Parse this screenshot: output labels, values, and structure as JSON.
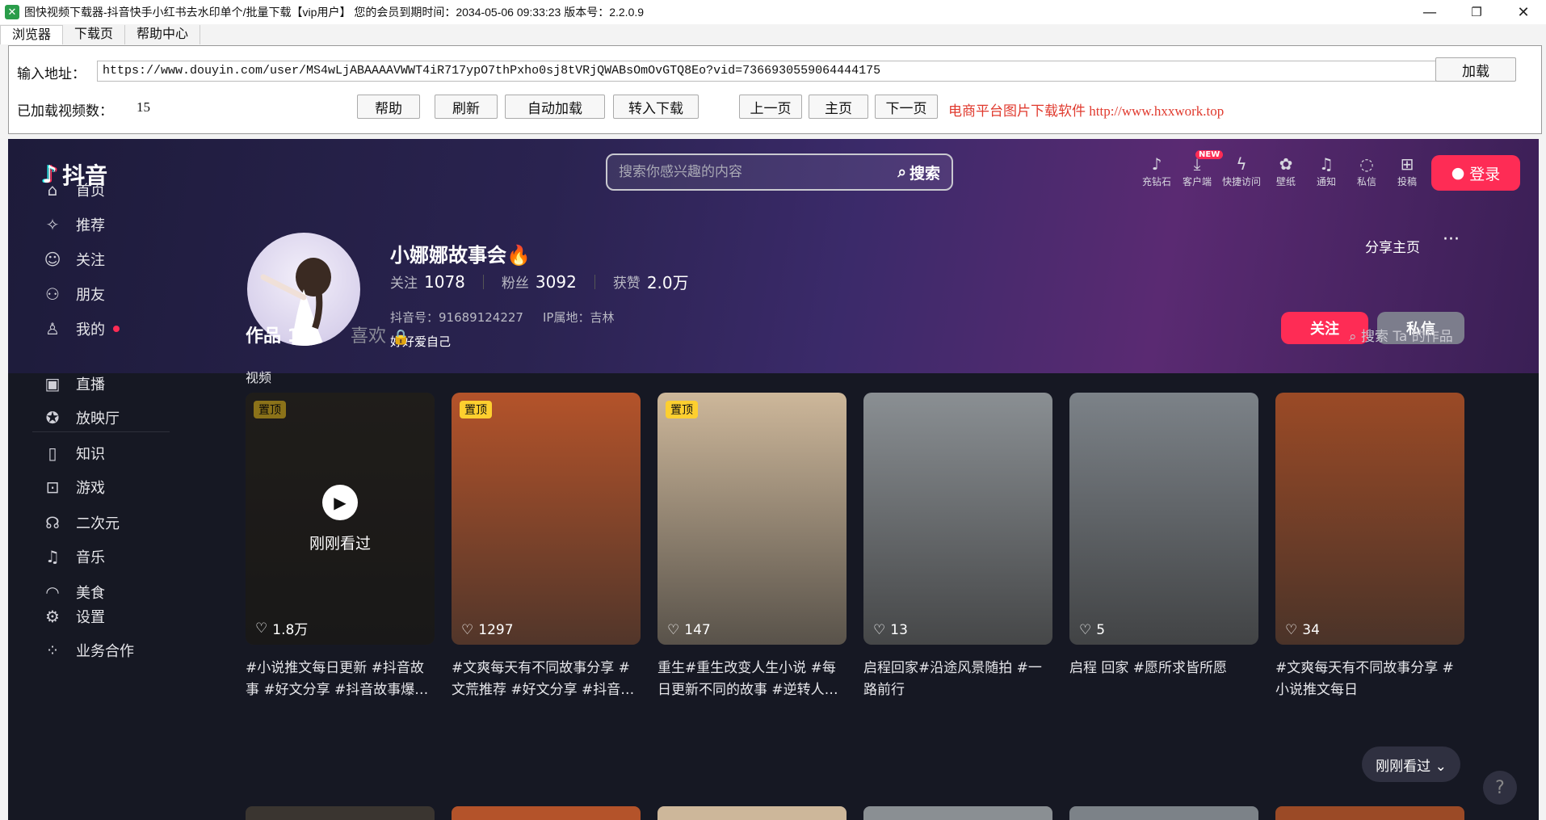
{
  "window": {
    "title": "图快视频下载器-抖音快手小红书去水印单个/批量下载【vip用户】 您的会员到期时间：2034-05-06 09:33:23   版本号：2.2.0.9",
    "minimize": "—",
    "maximize": "❐",
    "close": "✕"
  },
  "menu": {
    "browser": "浏览器",
    "download": "下载页",
    "help": "帮助中心"
  },
  "panel": {
    "url_label": "输入地址：",
    "url_value": "https://www.douyin.com/user/MS4wLjABAAAAVWWT4iR717ypO7thPxho0sj8tVRjQWABsOmOvGTQ8Eo?vid=7366930559064444175",
    "load_button": "加载",
    "loaded_label": "已加载视频数：",
    "loaded_count": "15",
    "btn_help": "帮助",
    "btn_refresh": "刷新",
    "btn_autoload": "自动加载",
    "btn_todownload": "转入下载",
    "btn_prev": "上一页",
    "btn_home": "主页",
    "btn_next": "下一页",
    "ad_text": "电商平台图片下载软件 http://www.hxxwork.top"
  },
  "douyin": {
    "logo_text": "抖音",
    "search_placeholder": "搜索你感兴趣的内容",
    "search_button": "搜索",
    "top_icons": [
      {
        "label": "充钻石",
        "icon": "diamond-icon"
      },
      {
        "label": "客户端",
        "icon": "download-icon"
      },
      {
        "label": "快捷访问",
        "icon": "lightning-icon"
      },
      {
        "label": "壁纸",
        "icon": "wallpaper-icon"
      },
      {
        "label": "通知",
        "icon": "bell-icon"
      },
      {
        "label": "私信",
        "icon": "chat-icon"
      },
      {
        "label": "投稿",
        "icon": "plus-icon"
      }
    ],
    "new_badge": "NEW",
    "login": "登录",
    "nav": [
      {
        "label": "首页",
        "icon": "home-icon"
      },
      {
        "label": "推荐",
        "icon": "sparkle-icon"
      },
      {
        "label": "关注",
        "icon": "follow-icon"
      },
      {
        "label": "朋友",
        "icon": "friends-icon"
      },
      {
        "label": "我的",
        "icon": "user-icon"
      },
      {
        "label": "直播",
        "icon": "tv-icon"
      },
      {
        "label": "放映厅",
        "icon": "film-icon"
      },
      {
        "label": "知识",
        "icon": "book-icon"
      },
      {
        "label": "游戏",
        "icon": "game-icon"
      },
      {
        "label": "二次元",
        "icon": "anime-icon"
      },
      {
        "label": "音乐",
        "icon": "music-icon"
      },
      {
        "label": "美食",
        "icon": "food-icon"
      },
      {
        "label": "设置",
        "icon": "settings-icon"
      },
      {
        "label": "业务合作",
        "icon": "grid-icon"
      }
    ],
    "profile": {
      "name": "小娜娜故事会",
      "follow_label": "关注",
      "follow_count": "1078",
      "fans_label": "粉丝",
      "fans_count": "3092",
      "likes_label": "获赞",
      "likes_count": "2.0万",
      "douyin_id": "抖音号：91689124227",
      "ip": "IP属地：吉林",
      "bio": "好好爱自己",
      "share": "分享主页",
      "more": "···",
      "follow_btn": "关注",
      "message_btn": "私信"
    },
    "tabs": {
      "works": "作品 15",
      "likes": "喜欢",
      "search_works": "搜索 Ta 的作品"
    },
    "section_video": "视频",
    "watched_label": "刚刚看过",
    "pin_label": "置顶",
    "videos": [
      {
        "likes": "1.8万",
        "caption": "#小说推文每日更新 #抖音故事 #好文分享 #抖音故事爆…",
        "pinned": true,
        "watched": true,
        "bg": "#3a3530"
      },
      {
        "likes": "1297",
        "caption": "#文爽每天有不同故事分享 #文荒推荐 #好文分享 #抖音…",
        "pinned": true,
        "watched": false,
        "bg": "#b4532a"
      },
      {
        "likes": "147",
        "caption": "重生#重生改变人生小说 #每日更新不同的故事 #逆转人…",
        "pinned": true,
        "watched": false,
        "bg": "#cdb79a"
      },
      {
        "likes": "13",
        "caption": "启程回家#沿途风景随拍 #一路前行",
        "pinned": false,
        "watched": false,
        "bg": "#8a8f93"
      },
      {
        "likes": "5",
        "caption": "启程 回家 #愿所求皆所愿",
        "pinned": false,
        "watched": false,
        "bg": "#7c8288"
      },
      {
        "likes": "34",
        "caption": "#文爽每天有不同故事分享 #小说推文每日",
        "pinned": false,
        "watched": false,
        "bg": "#9b4a26"
      }
    ],
    "floater": "刚刚看过 ⌄",
    "help_btn": "?"
  }
}
